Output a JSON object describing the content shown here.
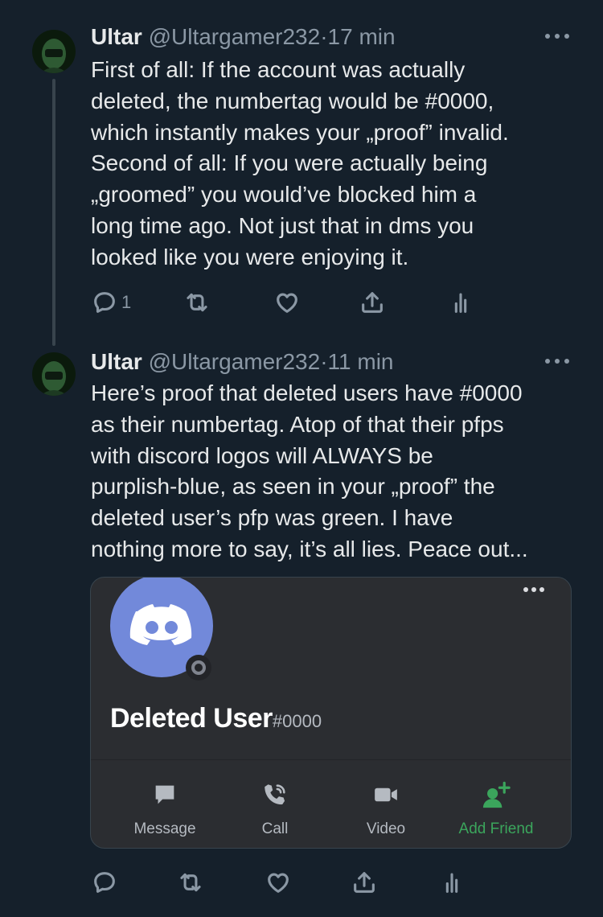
{
  "tweets": [
    {
      "name": "Ultar",
      "handle": "@Ultargamer232",
      "separator": "·",
      "time": "17 min",
      "text": "First of all: If the account was actually\ndeleted, the numbertag would be #0000,\nwhich instantly makes your „proof” invalid.\nSecond of all: If you were actually being\n„groomed” you would’ve blocked him a\nlong time ago. Not just that in dms you\nlooked like you were enjoying it.",
      "reply_count": "1"
    },
    {
      "name": "Ultar",
      "handle": "@Ultargamer232",
      "separator": "·",
      "time": "11 min",
      "text": "Here’s proof that deleted users have #0000\nas their numbertag. Atop of that their pfps\nwith discord logos will ALWAYS be\npurplish-blue, as seen in your „proof” the\ndeleted user’s pfp was green. I have\nnothing more to say, it’s all lies. Peace out...",
      "reply_count": ""
    }
  ],
  "discord_card": {
    "username": "Deleted User",
    "tag": "#0000",
    "buttons": {
      "message": "Message",
      "call": "Call",
      "video": "Video",
      "add_friend": "Add Friend"
    },
    "avatar_color": "#7289da",
    "add_friend_color": "#3ba55c"
  },
  "theme": {
    "background": "#15202b",
    "text": "#e7e9ea",
    "muted": "#8b98a5"
  }
}
